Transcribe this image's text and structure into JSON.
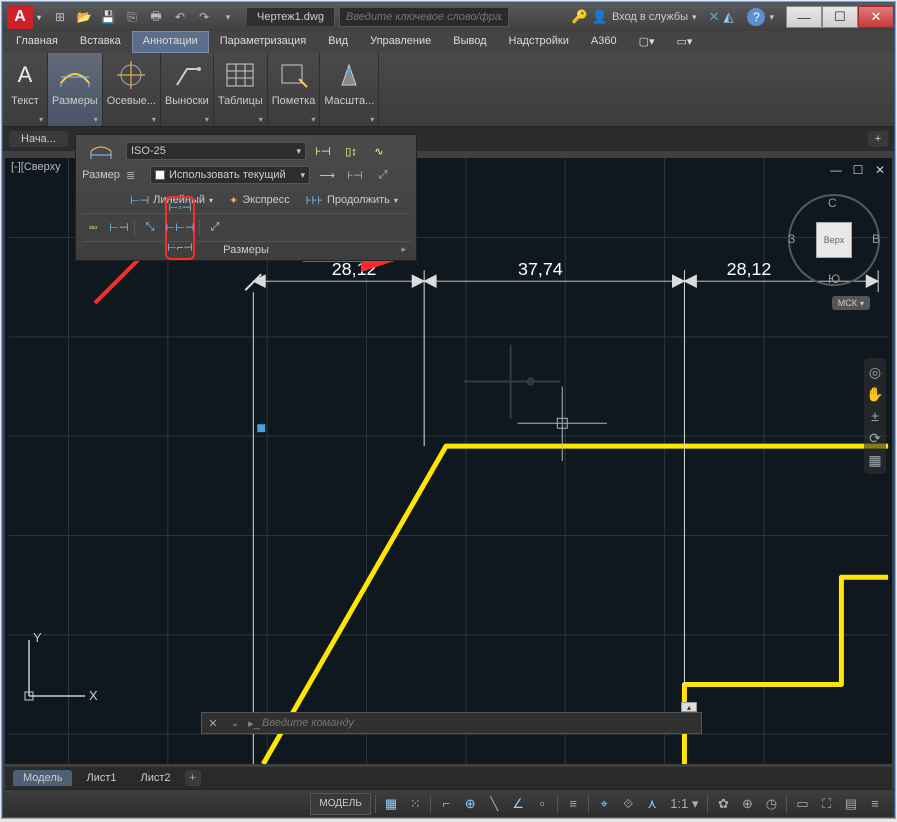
{
  "app": {
    "logo_letter": "A"
  },
  "qat": [
    "⊞",
    "🖿",
    "🗁",
    "🖫",
    "⎌",
    "↻",
    "🖶"
  ],
  "document": {
    "tab": "Чертеж1.dwg"
  },
  "search": {
    "placeholder": "Введите ключевое слово/фразу"
  },
  "signin": {
    "label": "Вход в службы"
  },
  "menu": {
    "items": [
      "Главная",
      "Вставка",
      "Аннотации",
      "Параметризация",
      "Вид",
      "Управление",
      "Вывод",
      "Надстройки",
      "A360"
    ],
    "active_index": 2
  },
  "ribbon": {
    "panels": [
      "Текст",
      "Размеры",
      "Осевые...",
      "Выноски",
      "Таблицы",
      "Пометка",
      "Масшта..."
    ],
    "active_index": 1
  },
  "dropdown": {
    "left_label": "Размер",
    "style_select": "ISO-25",
    "layer_select": "Использовать текущий",
    "row3": {
      "linear": "Линейный",
      "express": "Экспресс",
      "continue": "Продолжить"
    },
    "footer": "Размеры"
  },
  "file_tabs": {
    "start_label": "Нача..."
  },
  "viewport": {
    "top_left_label": "[-][Сверху",
    "dims": {
      "d1": "28,12",
      "d2": "37,74",
      "d3": "28,12"
    },
    "ucs": {
      "x": "X",
      "y": "Y"
    },
    "viewcube": {
      "top": "С",
      "right": "В",
      "bottom": "Ю",
      "left": "З",
      "face": "Верх"
    },
    "msk": "МСК"
  },
  "cmdline": {
    "placeholder": "Введите команду"
  },
  "layout_tabs": {
    "model": "Модель",
    "sheet1": "Лист1",
    "sheet2": "Лист2"
  },
  "status": {
    "model_label": "МОДЕЛЬ",
    "scale": "1:1"
  }
}
